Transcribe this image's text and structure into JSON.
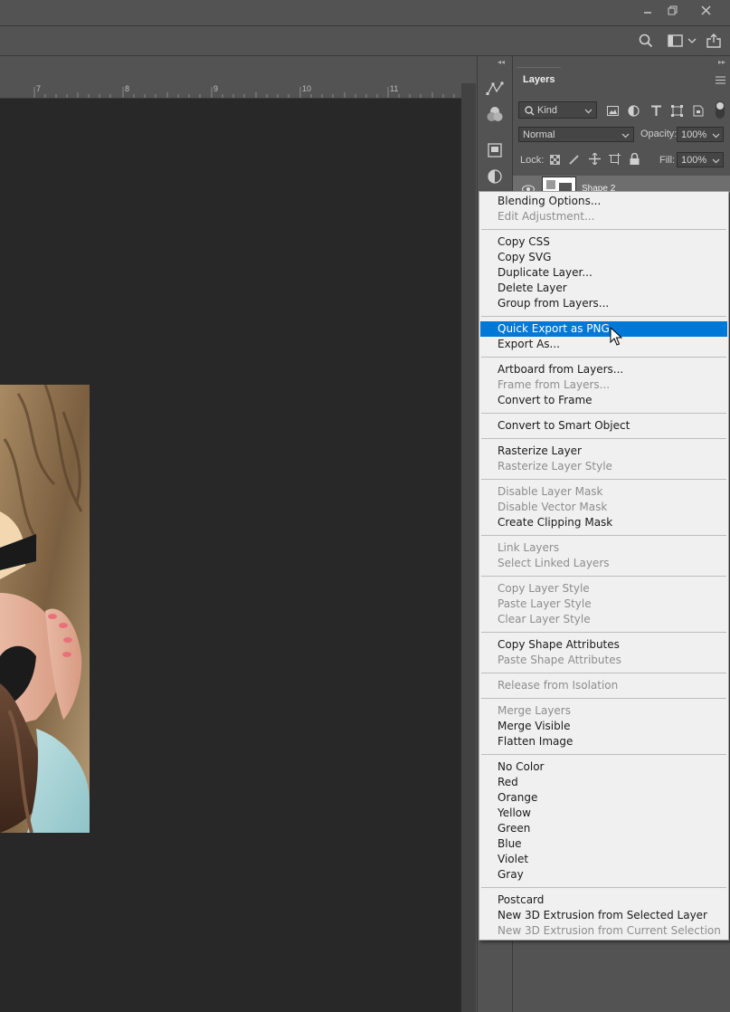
{
  "app": {
    "window_buttons": [
      {
        "name": "minimize-button",
        "icon": "minimize-icon"
      },
      {
        "name": "restore-button",
        "icon": "restore-icon"
      },
      {
        "name": "close-button",
        "icon": "close-icon"
      }
    ]
  },
  "optionsbar": {
    "icons": [
      "search-icon",
      "workspace-icon",
      "chevron-down-icon",
      "share-icon"
    ]
  },
  "ruler": {
    "ticks": [
      "7",
      "8",
      "9",
      "10",
      "11"
    ]
  },
  "layers_panel": {
    "tab_label": "Layers",
    "filter_kind": "Kind",
    "blend_mode": "Normal",
    "opacity_label": "Opacity:",
    "opacity_value": "100%",
    "lock_label": "Lock:",
    "fill_label": "Fill:",
    "fill_value": "100%",
    "layer_name": "Shape 2"
  },
  "context_menu": {
    "groups": [
      [
        {
          "label": "Blending Options...",
          "enabled": true
        },
        {
          "label": "Edit Adjustment...",
          "enabled": false
        }
      ],
      [
        {
          "label": "Copy CSS",
          "enabled": true
        },
        {
          "label": "Copy SVG",
          "enabled": true
        },
        {
          "label": "Duplicate Layer...",
          "enabled": true
        },
        {
          "label": "Delete Layer",
          "enabled": true
        },
        {
          "label": "Group from Layers...",
          "enabled": true
        }
      ],
      [
        {
          "label": "Quick Export as PNG",
          "enabled": true,
          "highlighted": true
        },
        {
          "label": "Export As...",
          "enabled": true
        }
      ],
      [
        {
          "label": "Artboard from Layers...",
          "enabled": true
        },
        {
          "label": "Frame from Layers...",
          "enabled": false
        },
        {
          "label": "Convert to Frame",
          "enabled": true
        }
      ],
      [
        {
          "label": "Convert to Smart Object",
          "enabled": true
        }
      ],
      [
        {
          "label": "Rasterize Layer",
          "enabled": true
        },
        {
          "label": "Rasterize Layer Style",
          "enabled": false
        }
      ],
      [
        {
          "label": "Disable Layer Mask",
          "enabled": false
        },
        {
          "label": "Disable Vector Mask",
          "enabled": false
        },
        {
          "label": "Create Clipping Mask",
          "enabled": true
        }
      ],
      [
        {
          "label": "Link Layers",
          "enabled": false
        },
        {
          "label": "Select Linked Layers",
          "enabled": false
        }
      ],
      [
        {
          "label": "Copy Layer Style",
          "enabled": false
        },
        {
          "label": "Paste Layer Style",
          "enabled": false
        },
        {
          "label": "Clear Layer Style",
          "enabled": false
        }
      ],
      [
        {
          "label": "Copy Shape Attributes",
          "enabled": true
        },
        {
          "label": "Paste Shape Attributes",
          "enabled": false
        }
      ],
      [
        {
          "label": "Release from Isolation",
          "enabled": false
        }
      ],
      [
        {
          "label": "Merge Layers",
          "enabled": false
        },
        {
          "label": "Merge Visible",
          "enabled": true
        },
        {
          "label": "Flatten Image",
          "enabled": true
        }
      ],
      [
        {
          "label": "No Color",
          "enabled": true
        },
        {
          "label": "Red",
          "enabled": true
        },
        {
          "label": "Orange",
          "enabled": true
        },
        {
          "label": "Yellow",
          "enabled": true
        },
        {
          "label": "Green",
          "enabled": true
        },
        {
          "label": "Blue",
          "enabled": true
        },
        {
          "label": "Violet",
          "enabled": true
        },
        {
          "label": "Gray",
          "enabled": true
        }
      ],
      [
        {
          "label": "Postcard",
          "enabled": true
        },
        {
          "label": "New 3D Extrusion from Selected Layer",
          "enabled": true
        },
        {
          "label": "New 3D Extrusion from Current Selection",
          "enabled": false
        }
      ]
    ]
  },
  "colors": {
    "highlight": "#0078d7",
    "menu_bg": "#f0f0f0",
    "canvas_bg": "#282828",
    "chrome_bg": "#535353"
  }
}
